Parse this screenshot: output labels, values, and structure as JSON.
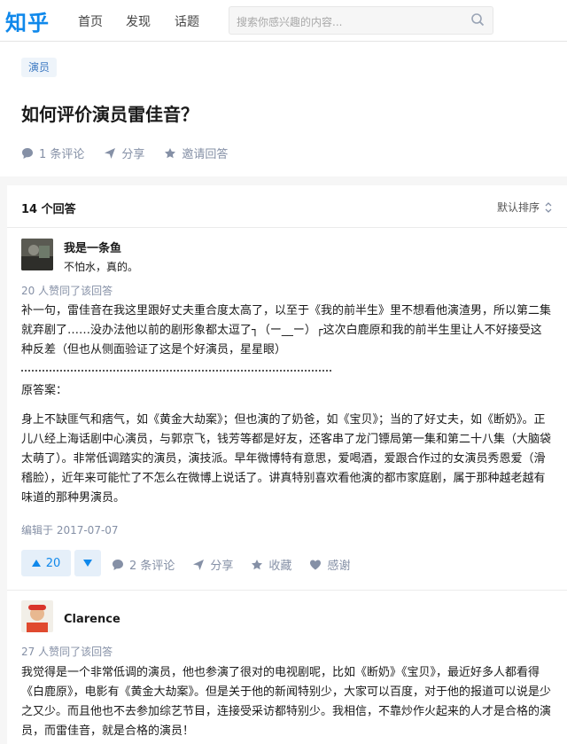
{
  "header": {
    "logo": "知乎",
    "nav": [
      "首页",
      "发现",
      "话题"
    ],
    "search_placeholder": "搜索你感兴趣的内容..."
  },
  "question": {
    "tag": "演员",
    "title": "如何评价演员雷佳音？",
    "actions": {
      "comments": "1 条评论",
      "share": "分享",
      "invite": "邀请回答"
    }
  },
  "answers_header": {
    "count": "14 个回答",
    "sort": "默认排序"
  },
  "answer1": {
    "author": "我是一条鱼",
    "bio": "不怕水，真的。",
    "upvote_info": "20 人赞同了该回答",
    "p1": "补一句，雷佳音在我这里跟好丈夫重合度太高了，以至于《我的前半生》里不想看他演渣男，所以第二集就弃剧了……没办法他以前的剧形象都太逗了┐（ー__ー）┌这次白鹿原和我的前半生里让人不好接受这种反差（但也从侧面验证了这是个好演员，星星眼）",
    "original_label": "原答案：",
    "p2": "身上不缺匪气和痞气，如《黄金大劫案》；但也演的了奶爸，如《宝贝》；当的了好丈夫，如《断奶》。正儿八经上海话剧中心演员，与郭京飞，钱芳等都是好友，还客串了龙门镖局第一集和第二十八集（大脑袋太萌了）。非常低调踏实的演员，演技派。早年微博特有意思，爱喝酒，爱跟合作过的女演员秀恩爱（滑稽脸），近年来可能忙了不怎么在微博上说话了。讲真特别喜欢看他演的都市家庭剧，属于那种越老越有味道的那种男演员。",
    "edited": "编辑于 2017-07-07",
    "votes": "20",
    "actions": {
      "comments": "2 条评论",
      "share": "分享",
      "collect": "收藏",
      "thanks": "感谢"
    }
  },
  "answer2": {
    "author": "Clarence",
    "upvote_info": "27 人赞同了该回答",
    "p1": "我觉得是一个非常低调的演员，他也参演了很对的电视剧呢，比如《断奶》《宝贝》，最近好多人都看得《白鹿原》，电影有《黄金大劫案》。但是关于他的新闻特别少，大家可以百度，对于他的报道可以说是少之又少。而且他也不去参加综艺节目，连接受采访都特别少。我相信，不靠炒作火起来的人才是合格的演员，而雷佳音，就是合格的演员！"
  },
  "colors": {
    "brand": "#0f88eb",
    "meta": "#8590a6",
    "vote_bg": "#e5eff9"
  }
}
